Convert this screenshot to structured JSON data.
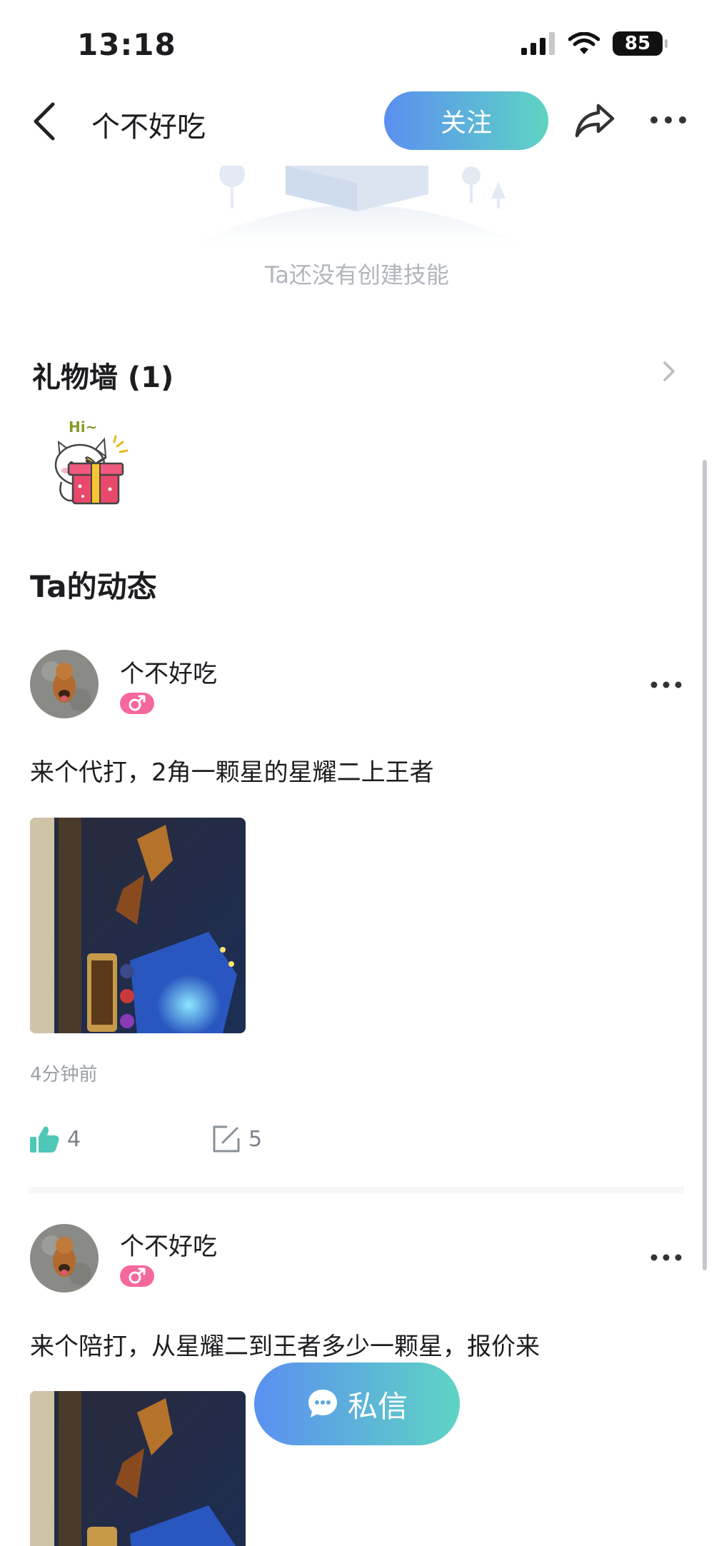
{
  "status_bar": {
    "time": "13:18",
    "battery": "85"
  },
  "nav": {
    "title": "个不好吃",
    "follow_label": "关注"
  },
  "skills": {
    "empty_text": "Ta还没有创建技能"
  },
  "gift_wall": {
    "title": "礼物墙 (1)",
    "gift_caption": "Hi~"
  },
  "moments": {
    "title": "Ta的动态"
  },
  "posts": [
    {
      "name": "个不好吃",
      "text": "来个代打，2角一颗星的星耀二上王者",
      "time": "4分钟前",
      "likes": "4",
      "comments": "5"
    },
    {
      "name": "个不好吃",
      "text": "来个陪打，从星耀二到王者多少一颗星，报价来"
    }
  ],
  "dm_button": {
    "label": "私信"
  },
  "colors": {
    "accent_start": "#5b8ff0",
    "accent_end": "#5ed4c4",
    "like": "#4fc7b7",
    "gender": "#f5689c"
  }
}
